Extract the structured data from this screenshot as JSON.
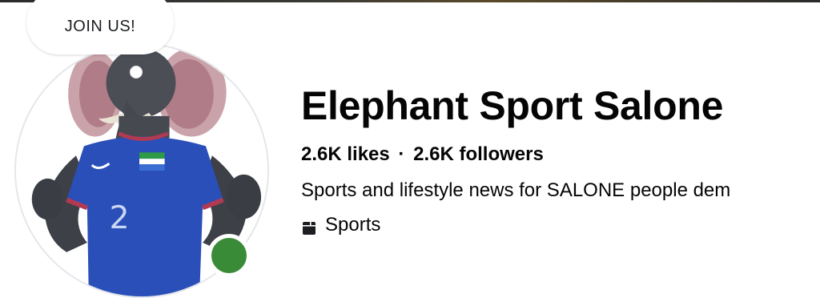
{
  "speech_bubble": {
    "text": "JOIN US!"
  },
  "page": {
    "name": "Elephant Sport Salone",
    "likes": "2.6K likes",
    "separator": "·",
    "followers": "2.6K followers",
    "bio": "Sports and lifestyle news for SALONE people dem",
    "category": "Sports",
    "category_icon": "tag-icon"
  },
  "avatar": {
    "jersey_number": "2",
    "online_status_color": "#3a8b37",
    "jersey_color": "#2a4fb8"
  }
}
